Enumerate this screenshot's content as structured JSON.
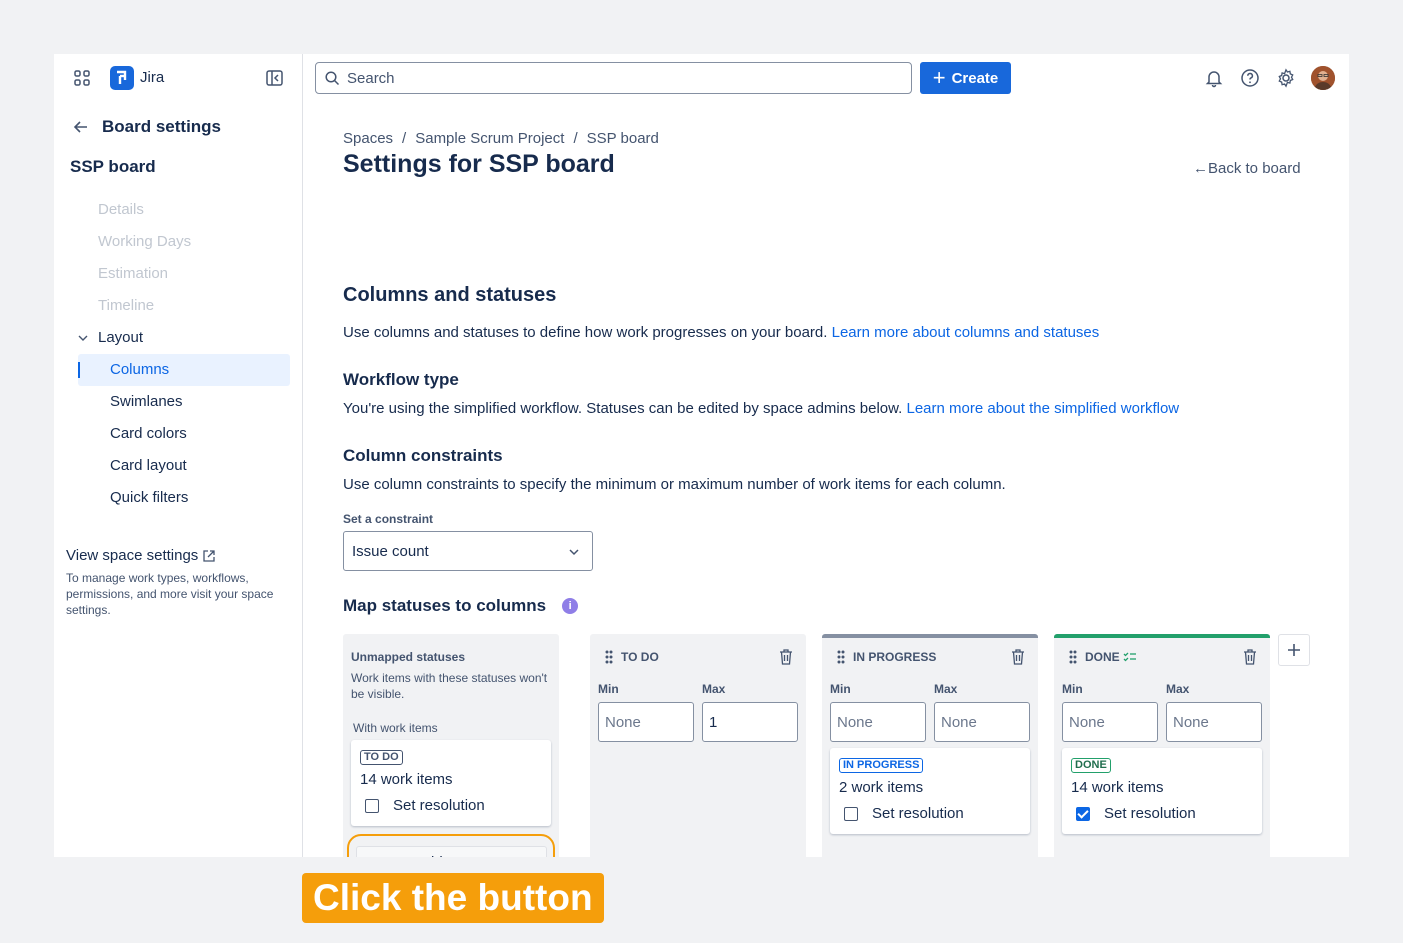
{
  "app": {
    "name": "Jira"
  },
  "sidebar": {
    "back_label": "Board settings",
    "board_name": "SSP board",
    "items": [
      {
        "label": "Details"
      },
      {
        "label": "Working Days"
      },
      {
        "label": "Estimation"
      },
      {
        "label": "Timeline"
      },
      {
        "label": "Layout"
      },
      {
        "label": "Columns"
      },
      {
        "label": "Swimlanes"
      },
      {
        "label": "Card colors"
      },
      {
        "label": "Card layout"
      },
      {
        "label": "Quick filters"
      }
    ],
    "view_space_settings": "View space settings",
    "view_space_desc": "To manage work types, workflows, permissions, and more visit your space settings."
  },
  "header": {
    "search_placeholder": "Search",
    "create_label": "Create"
  },
  "main": {
    "breadcrumbs": [
      "Spaces",
      "Sample Scrum Project",
      "SSP board"
    ],
    "title": "Settings for SSP board",
    "back_to_board": "←Back to board",
    "section_title": "Columns and statuses",
    "section_desc": "Use columns and statuses to define how work progresses on your board.",
    "section_link": "Learn more about columns and statuses",
    "workflow_title": "Workflow type",
    "workflow_desc": "You're using the simplified workflow. Statuses can be edited by space admins below.",
    "workflow_link": "Learn more about the simplified workflow",
    "constraints_title": "Column constraints",
    "constraints_desc": "Use column constraints to specify the minimum or maximum number of work items for each column.",
    "set_constraint_label": "Set a constraint",
    "constraint_value": "Issue count",
    "map_title": "Map statuses to columns",
    "info_glyph": "i"
  },
  "unmapped": {
    "title": "Unmapped statuses",
    "desc": "Work items with these statuses won't be visible.",
    "with_items": "With work items",
    "card": {
      "status": "TO DO",
      "count": "14 work items",
      "resolution": "Set resolution"
    },
    "add_status": "Add status"
  },
  "columns": [
    {
      "name": "TO DO",
      "min_label": "Min",
      "max_label": "Max",
      "min": "None",
      "max": "1"
    },
    {
      "name": "IN PROGRESS",
      "min_label": "Min",
      "max_label": "Max",
      "min": "None",
      "max": "None",
      "card": {
        "status": "IN PROGRESS",
        "count": "2 work items",
        "resolution": "Set resolution"
      }
    },
    {
      "name": "DONE",
      "min_label": "Min",
      "max_label": "Max",
      "min": "None",
      "max": "None",
      "card": {
        "status": "DONE",
        "count": "14 work items",
        "resolution": "Set resolution",
        "resolution_checked": true
      }
    }
  ],
  "tooltip": "Click the button",
  "colors": {
    "accent": "#1868db",
    "highlight": "#f59e0b",
    "done": "#22a06b"
  }
}
